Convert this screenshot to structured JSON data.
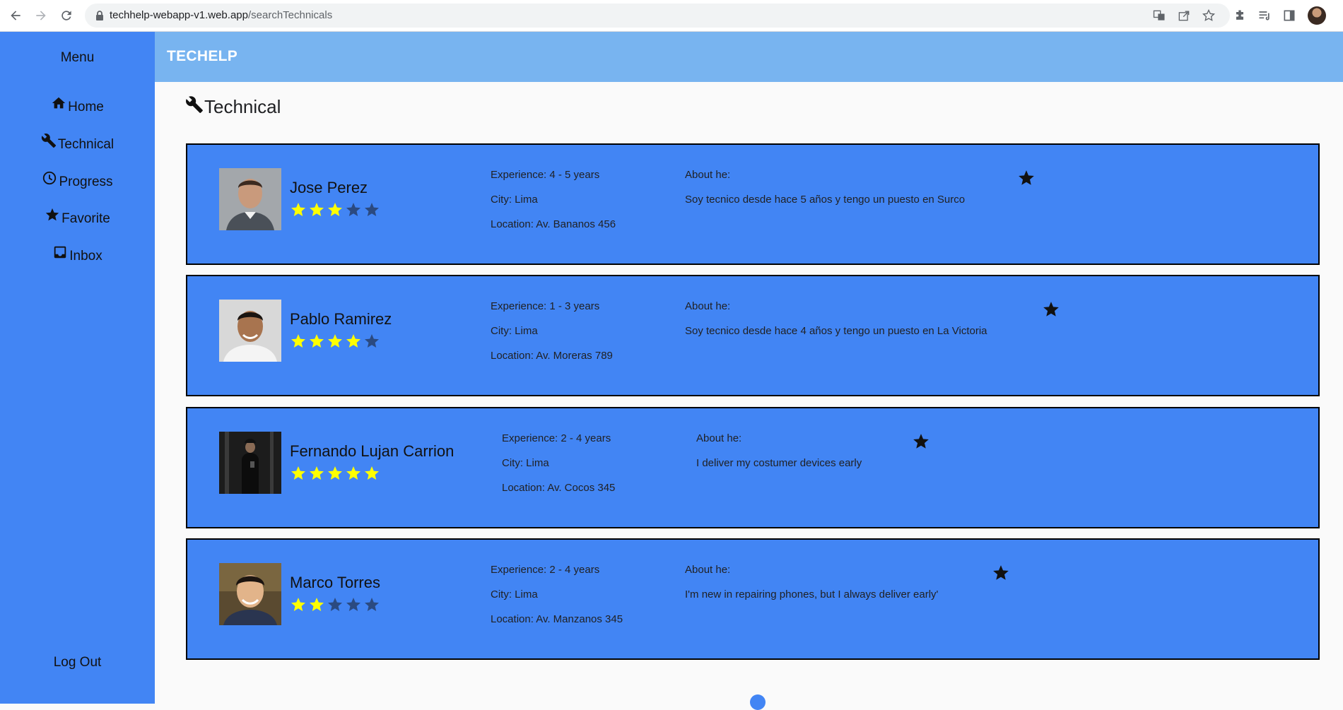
{
  "browser": {
    "url_host": "techhelp-webapp-v1.web.app",
    "url_path": "/searchTechnicals"
  },
  "sidebar": {
    "title": "Menu",
    "items": [
      {
        "label": "Home",
        "icon": "home-icon"
      },
      {
        "label": "Technical",
        "icon": "wrench-icon"
      },
      {
        "label": "Progress",
        "icon": "clock-icon"
      },
      {
        "label": "Favorite",
        "icon": "star-icon"
      },
      {
        "label": "Inbox",
        "icon": "inbox-icon"
      }
    ],
    "logout_label": "Log Out"
  },
  "header": {
    "brand": "TECHELP"
  },
  "page": {
    "title": "Technical",
    "title_icon": "wrench-icon"
  },
  "colors": {
    "primary": "#4285f4",
    "header": "#78b4f0",
    "star_filled": "#ffff00",
    "star_empty": "#2b4a80"
  },
  "technicians": [
    {
      "name": "Jose Perez",
      "rating": 3,
      "experience": "Experience: 4 - 5 years",
      "city": "City: Lima",
      "location": "Location: Av. Bananos 456",
      "about_label": "About he:",
      "about": "Soy tecnico desde hace 5 años y tengo un puesto en Surco"
    },
    {
      "name": "Pablo Ramirez",
      "rating": 4,
      "experience": "Experience: 1 - 3 years",
      "city": "City: Lima",
      "location": "Location: Av. Moreras 789",
      "about_label": "About he:",
      "about": "Soy tecnico desde hace 4 años y tengo un puesto en La Victoria"
    },
    {
      "name": "Fernando Lujan Carrion",
      "rating": 5,
      "experience": "Experience: 2 - 4 years",
      "city": "City: Lima",
      "location": "Location: Av. Cocos 345",
      "about_label": "About he:",
      "about": "I deliver my costumer devices early"
    },
    {
      "name": "Marco Torres",
      "rating": 2,
      "experience": "Experience: 2 - 4 years",
      "city": "City: Lima",
      "location": "Location: Av. Manzanos 345",
      "about_label": "About he:",
      "about": "I'm new in repairing phones, but I always deliver early'"
    }
  ]
}
